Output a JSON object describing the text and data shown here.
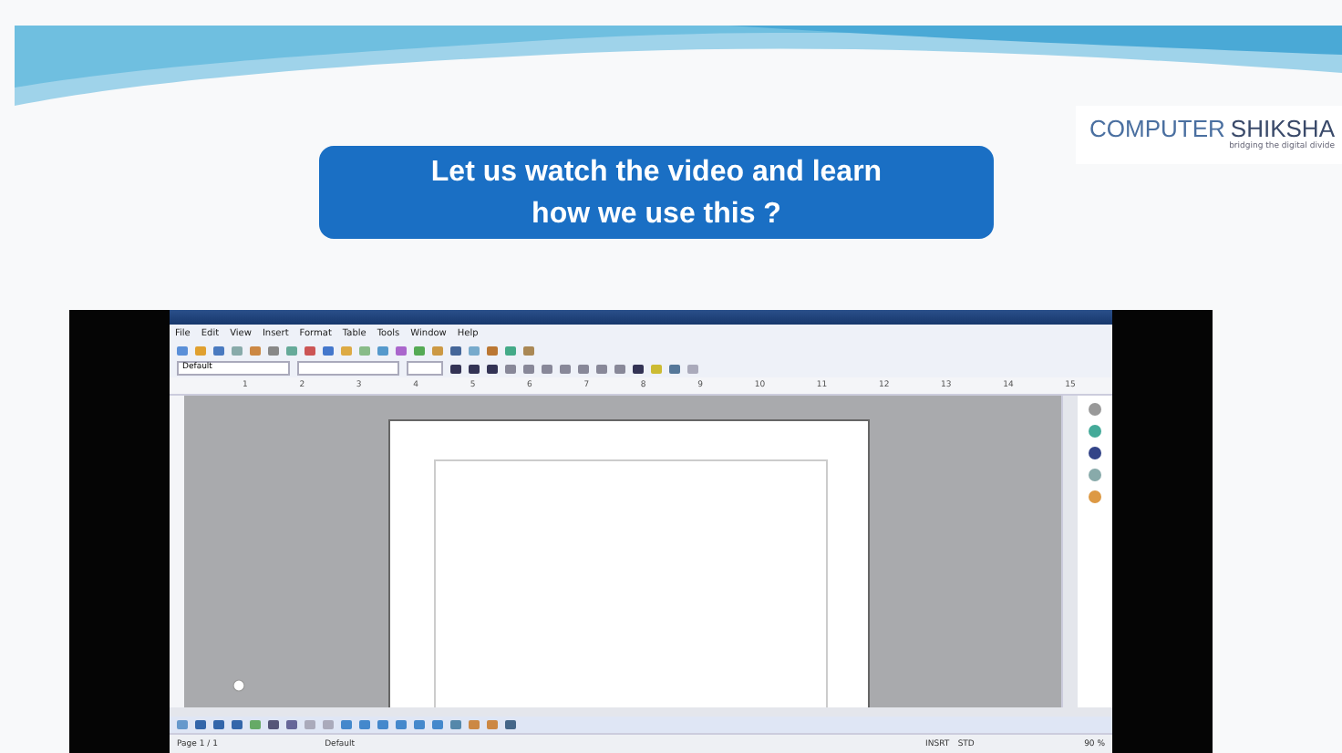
{
  "logo": {
    "name_part_1": "COMPUTER",
    "name_part_2": "SHIKSHA",
    "tagline": "bridging the digital divide"
  },
  "banner": {
    "lines": [
      "Let us watch the video and learn",
      "how we use this ?"
    ]
  },
  "video": {
    "menu": [
      "File",
      "Edit",
      "View",
      "Insert",
      "Format",
      "Table",
      "Tools",
      "Window",
      "Help"
    ],
    "style_box": "Default",
    "ruler": [
      "1",
      "2",
      "3",
      "4",
      "5",
      "6",
      "7",
      "8",
      "9",
      "10",
      "11",
      "12",
      "13",
      "14",
      "15"
    ],
    "status_bar": [
      "Page 1 / 1",
      "Default",
      "INSRT",
      "STD",
      "90 %"
    ]
  }
}
